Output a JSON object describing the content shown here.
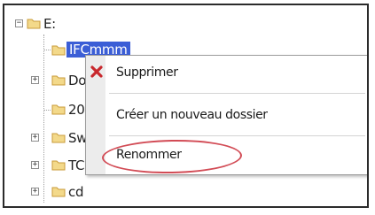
{
  "tree": {
    "root_expander": "−",
    "root_label": "E:",
    "items": [
      {
        "label": "IFCmmm",
        "expander": ""
      },
      {
        "label": "Do",
        "expander": "+"
      },
      {
        "label": "20",
        "expander": ""
      },
      {
        "label": "Sw",
        "expander": "+"
      },
      {
        "label": "TC",
        "expander": "+"
      },
      {
        "label": "cd",
        "expander": "+"
      }
    ]
  },
  "context_menu": {
    "delete_label": "Supprimer",
    "new_folder_label": "Créer un nouveau dossier",
    "rename_label": "Renommer"
  },
  "colors": {
    "folder_fill": "#f3d98a",
    "folder_stroke": "#c89b3a",
    "delete_icon": "#c8282d",
    "selection": "#3b5ed6",
    "highlight_ellipse": "#d24b55"
  }
}
